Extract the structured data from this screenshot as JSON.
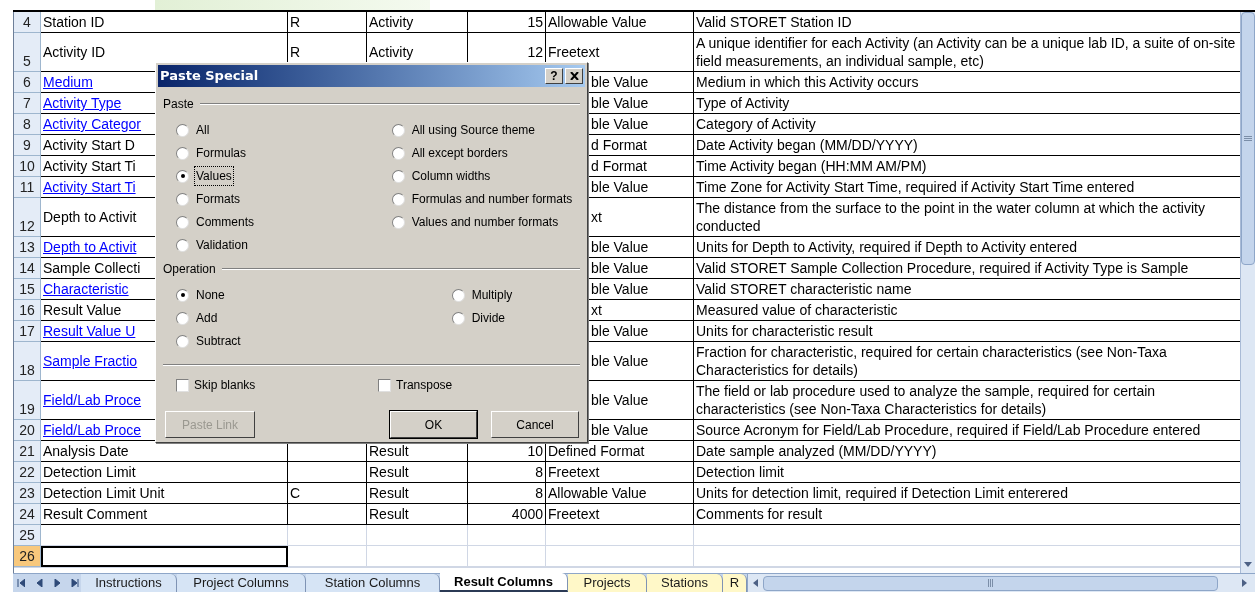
{
  "sheet": {
    "rows": [
      {
        "num": "4",
        "name": "Station ID",
        "link": false,
        "req": "R",
        "group": "Activity",
        "length": "15",
        "format": "Allowable Value",
        "description": "Valid STORET Station ID",
        "covered": false,
        "selected": false
      },
      {
        "num": "5",
        "name": "Activity ID",
        "link": false,
        "req": "R",
        "group": "Activity",
        "length": "12",
        "format": "Freetext",
        "description": "A unique identifier for each Activity (an Activity can be a unique lab ID, a suite of on-site field measurements, an individual sample, etc)",
        "covered": false,
        "selected": false
      },
      {
        "num": "6",
        "name": "Medium",
        "link": true,
        "format": "ble Value",
        "description": "Medium in which this Activity occurs",
        "covered": true,
        "selected": false
      },
      {
        "num": "7",
        "name": "Activity Type",
        "link": true,
        "format": "ble Value",
        "description": "Type of Activity",
        "covered": true,
        "selected": false
      },
      {
        "num": "8",
        "name": "Activity Categor",
        "link": true,
        "format": "ble Value",
        "description": "Category of Activity",
        "covered": true,
        "selected": false
      },
      {
        "num": "9",
        "name": "Activity Start D",
        "link": false,
        "format": "d Format",
        "description": "Date Activity began (MM/DD/YYYY)",
        "covered": true,
        "selected": false
      },
      {
        "num": "10",
        "name": "Activity Start Ti",
        "link": false,
        "format": "d Format",
        "description": "Time Activity began (HH:MM AM/PM)",
        "covered": true,
        "selected": false
      },
      {
        "num": "11",
        "name": "Activity Start Ti",
        "link": true,
        "format": "ble Value",
        "description": "Time Zone for Activity Start Time, required if Activity Start Time entered",
        "covered": true,
        "selected": false
      },
      {
        "num": "12",
        "name": "Depth to Activit",
        "link": false,
        "format": "xt",
        "description": "The distance from the surface to the point in the water column at which the activity conducted",
        "covered": true,
        "selected": false
      },
      {
        "num": "13",
        "name": "Depth to Activit",
        "link": true,
        "format": "ble Value",
        "description": "Units for Depth to Activity, required if Depth to Activity entered",
        "covered": true,
        "selected": false
      },
      {
        "num": "14",
        "name": "Sample Collecti",
        "link": false,
        "format": "ble Value",
        "description": "Valid STORET Sample Collection Procedure, required if Activity Type is Sample",
        "covered": true,
        "selected": false
      },
      {
        "num": "15",
        "name": "Characteristic",
        "link": true,
        "format": "ble Value",
        "description": "Valid STORET characteristic name",
        "covered": true,
        "selected": false
      },
      {
        "num": "16",
        "name": "Result Value",
        "link": false,
        "format": "xt",
        "description": "Measured value of characteristic",
        "covered": true,
        "selected": false
      },
      {
        "num": "17",
        "name": "Result Value U",
        "link": true,
        "format": "ble Value",
        "description": "Units for characteristic result",
        "covered": true,
        "selected": false
      },
      {
        "num": "18",
        "name": "Sample Fractio",
        "link": true,
        "format": "ble Value",
        "description": "Fraction for characteristic, required for certain characteristics (see Non-Taxa Characteristics for details)",
        "covered": true,
        "selected": false
      },
      {
        "num": "19",
        "name": "Field/Lab Proce",
        "link": true,
        "format": "ble Value",
        "description": "The field or lab procedure used to analyze the sample, required for certain characteristics (see Non-Taxa Characteristics for details)",
        "covered": true,
        "selected": false
      },
      {
        "num": "20",
        "name": "Field/Lab Proce",
        "link": true,
        "format": "ble Value",
        "description": "Source Acronym for Field/Lab Procedure, required if Field/Lab Procedure entered",
        "covered": true,
        "selected": false
      },
      {
        "num": "21",
        "name": "Analysis Date",
        "link": false,
        "group": "Result",
        "length": "10",
        "format": "Defined Format",
        "description": "Date sample analyzed (MM/DD/YYYY)",
        "covered": false,
        "selected": false
      },
      {
        "num": "22",
        "name": "Detection Limit",
        "link": false,
        "group": "Result",
        "length": "8",
        "format": "Freetext",
        "description": "Detection limit",
        "covered": false,
        "selected": false
      },
      {
        "num": "23",
        "name": "Detection Limit Unit",
        "link": false,
        "req": "C",
        "group": "Result",
        "length": "8",
        "format": "Allowable Value",
        "description": "Units for detection limit, required if Detection Limit enterered",
        "covered": false,
        "selected": false
      },
      {
        "num": "24",
        "name": "Result Comment",
        "link": false,
        "group": "Result",
        "length": "4000",
        "format": "Freetext",
        "description": "Comments for result",
        "covered": false,
        "selected": false
      },
      {
        "num": "25",
        "selected": false
      },
      {
        "num": "26",
        "selected": true
      }
    ]
  },
  "sheet_tabs": [
    {
      "label": "Instructions",
      "selected": false,
      "color": "#d6e4f5"
    },
    {
      "label": "Project Columns",
      "selected": false,
      "color": "#d6e4f5"
    },
    {
      "label": "Station Columns",
      "selected": false,
      "color": "#d6e4f5"
    },
    {
      "label": "Result Columns",
      "selected": true,
      "color": "#ffffff"
    },
    {
      "label": "Projects",
      "selected": false,
      "color": "#fff8c8"
    },
    {
      "label": "Stations",
      "selected": false,
      "color": "#fff8c8"
    },
    {
      "label": "R",
      "selected": false,
      "color": "#fff8c8"
    }
  ],
  "dialog": {
    "title": "Paste Special",
    "help_button": "?",
    "paste": {
      "label": "Paste",
      "options": [
        {
          "label": "All",
          "selected": false
        },
        {
          "label": "Formulas",
          "selected": false
        },
        {
          "label": "Values",
          "selected": true
        },
        {
          "label": "Formats",
          "selected": false
        },
        {
          "label": "Comments",
          "selected": false
        },
        {
          "label": "Validation",
          "selected": false
        },
        {
          "label": "All using Source theme",
          "selected": false
        },
        {
          "label": "All except borders",
          "selected": false
        },
        {
          "label": "Column widths",
          "selected": false
        },
        {
          "label": "Formulas and number formats",
          "selected": false
        },
        {
          "label": "Values and number formats",
          "selected": false
        }
      ]
    },
    "operation": {
      "label": "Operation",
      "options": [
        {
          "label": "None",
          "selected": true
        },
        {
          "label": "Add",
          "selected": false
        },
        {
          "label": "Subtract",
          "selected": false
        },
        {
          "label": "Multiply",
          "selected": false
        },
        {
          "label": "Divide",
          "selected": false
        }
      ]
    },
    "checkboxes": [
      {
        "label": "Skip blanks",
        "checked": false
      },
      {
        "label": "Transpose",
        "checked": false
      }
    ],
    "buttons": [
      {
        "label": "Paste Link",
        "disabled": true,
        "default": false
      },
      {
        "label": "OK",
        "disabled": false,
        "default": true
      },
      {
        "label": "Cancel",
        "disabled": false,
        "default": false
      }
    ]
  }
}
